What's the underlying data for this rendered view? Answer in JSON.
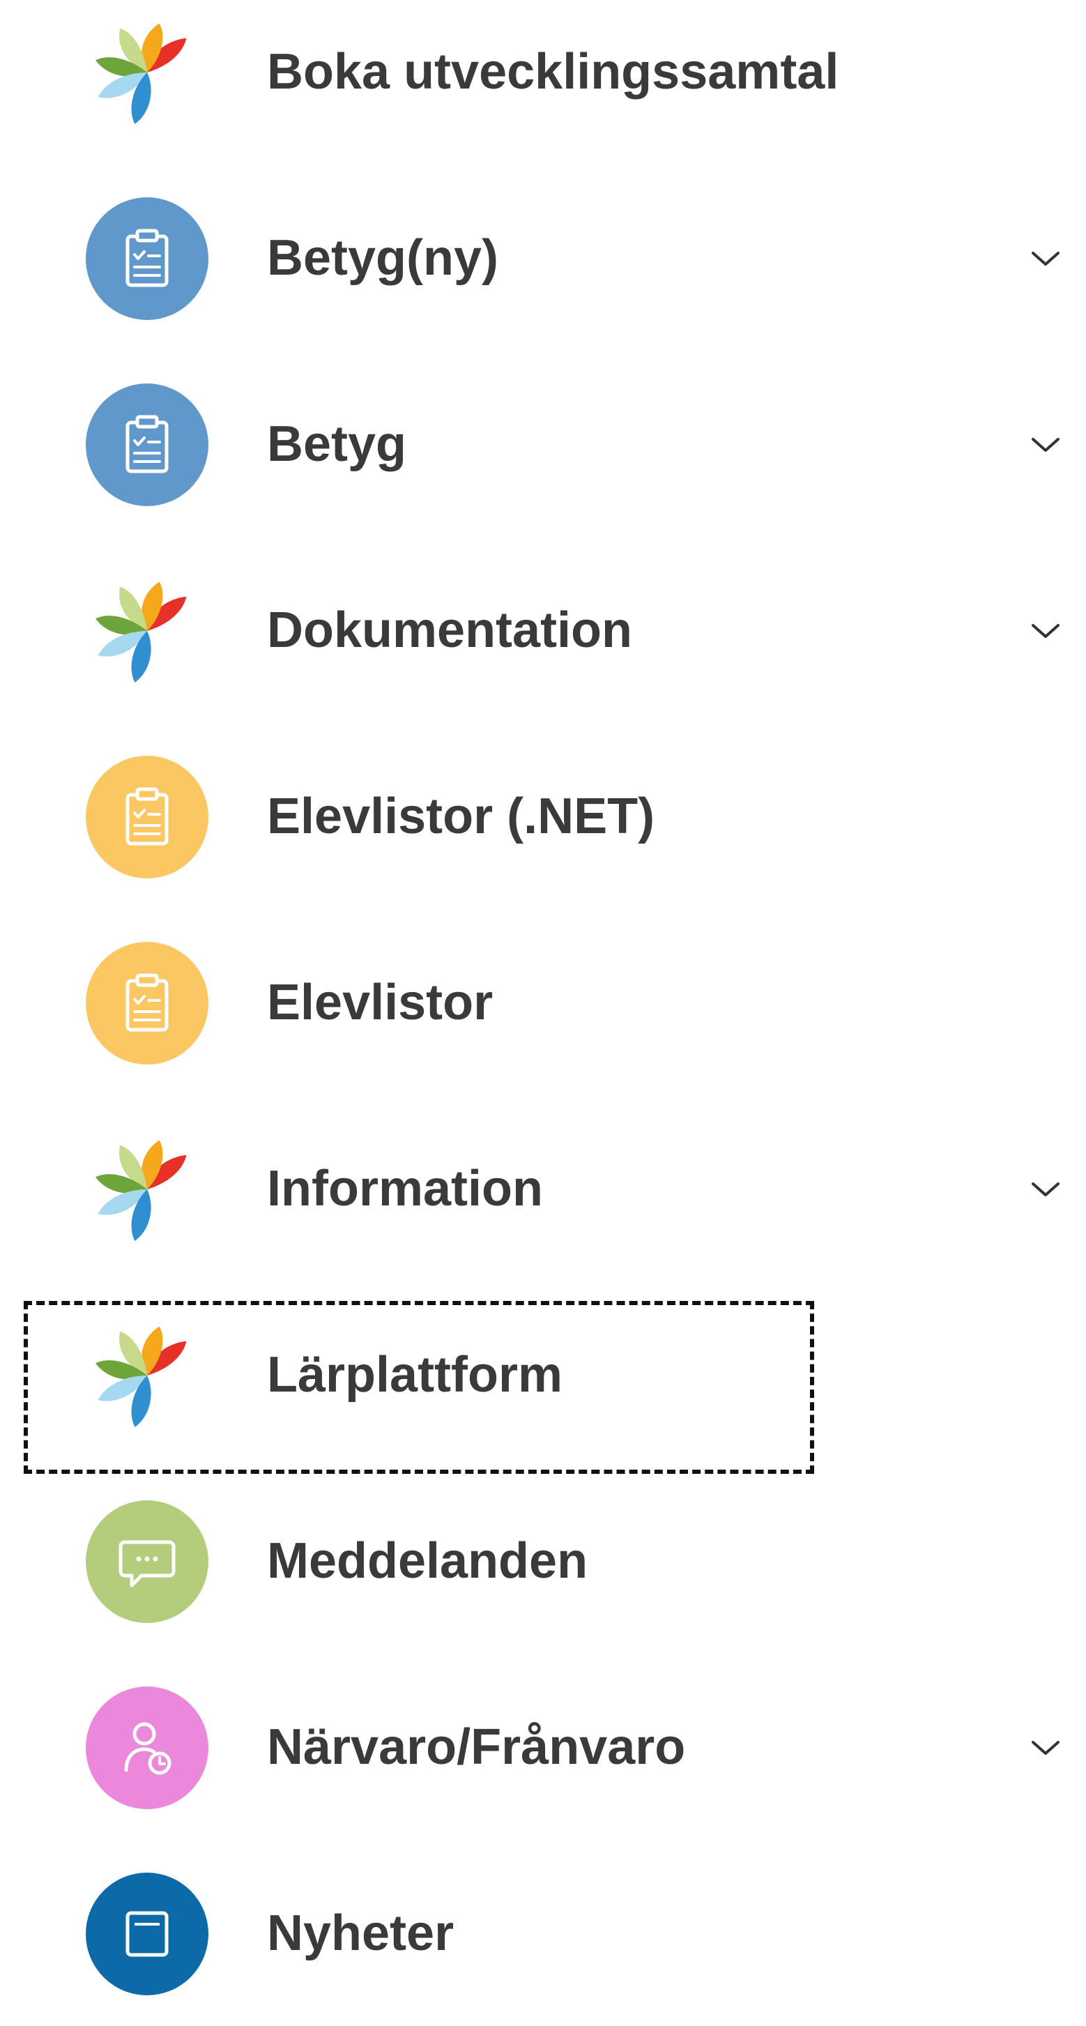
{
  "menu": {
    "items": [
      {
        "label": "Boka utvecklingssamtal",
        "icon": "school-logo-icon",
        "expandable": false
      },
      {
        "label": "Betyg(ny)",
        "icon": "clipboard-icon",
        "color": "#6198cc",
        "expandable": true
      },
      {
        "label": "Betyg",
        "icon": "clipboard-icon",
        "color": "#6198cc",
        "expandable": true
      },
      {
        "label": "Dokumentation",
        "icon": "school-logo-icon",
        "expandable": true
      },
      {
        "label": "Elevlistor (.NET)",
        "icon": "clipboard-icon",
        "color": "#fbc763",
        "expandable": false
      },
      {
        "label": "Elevlistor",
        "icon": "clipboard-icon",
        "color": "#fbc763",
        "expandable": false
      },
      {
        "label": "Information",
        "icon": "school-logo-icon",
        "expandable": true
      },
      {
        "label": "Lärplattform",
        "icon": "school-logo-icon",
        "expandable": false,
        "focused": true
      },
      {
        "label": "Meddelanden",
        "icon": "chat-bubble-icon",
        "color": "#b3cd7c",
        "expandable": false
      },
      {
        "label": "Närvaro/Frånvaro",
        "icon": "person-clock-icon",
        "color": "#ec88dc",
        "expandable": true
      },
      {
        "label": "Nyheter",
        "icon": "news-icon",
        "color": "#0d6aa8",
        "expandable": false
      }
    ]
  },
  "colors": {
    "text": "#3a3a3a",
    "chevron": "#333333",
    "logo_red": "#e63028",
    "logo_orange": "#f6a81c",
    "logo_lightgreen": "#c7d98a",
    "logo_green": "#6ea53a",
    "logo_lightblue": "#a6d8f0",
    "logo_blue": "#2f8fd0"
  }
}
